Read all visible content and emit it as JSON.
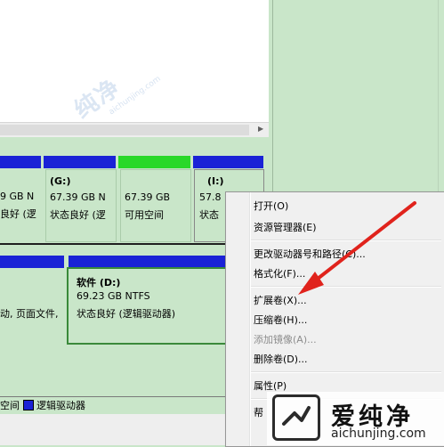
{
  "volumes_top": [
    {
      "size": "9 GB N",
      "status": "良好 (逻"
    },
    {
      "label": "(G:)",
      "size": "67.39 GB N",
      "status": "状态良好 (逻"
    },
    {
      "label": "",
      "size": "67.39 GB",
      "status": "可用空间"
    },
    {
      "label": "(I:)",
      "size": "57.8",
      "status": "状态"
    }
  ],
  "volumes_bottom": [
    {
      "status": "动, 页面文件,"
    },
    {
      "label": "软件 (D:)",
      "size": "69.23 GB NTFS",
      "status": "状态良好 (逻辑驱动器)"
    }
  ],
  "legend": {
    "free_space": "空间",
    "logical_drive": "逻辑驱动器"
  },
  "colors": {
    "primary_partition": "#1a22d6",
    "free_space": "#29d829",
    "selected_border": "#3a8a3a",
    "arrow": "#e0231c"
  },
  "context_menu": {
    "items": [
      {
        "label": "打开(O)",
        "enabled": true
      },
      {
        "label": "资源管理器(E)",
        "enabled": true
      },
      {
        "label": "更改驱动器号和路径(C)...",
        "enabled": true
      },
      {
        "label": "格式化(F)...",
        "enabled": true
      },
      {
        "label": "扩展卷(X)...",
        "enabled": true
      },
      {
        "label": "压缩卷(H)...",
        "enabled": true
      },
      {
        "label": "添加镜像(A)...",
        "enabled": false
      },
      {
        "label": "删除卷(D)...",
        "enabled": true
      },
      {
        "label": "属性(P)",
        "enabled": true
      },
      {
        "label": "帮",
        "enabled": true
      }
    ]
  },
  "watermark": {
    "center_text": "纯净",
    "center_url": "aichunjing.com",
    "logo_text": "爱纯净",
    "logo_url": "aichunjing.com"
  },
  "icons": {
    "scroll_right": "triangle-right-icon",
    "logo": "aichunjing-logo-icon"
  }
}
